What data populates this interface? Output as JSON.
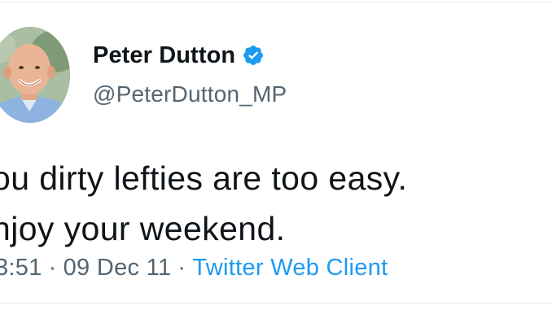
{
  "author": {
    "display_name": "Peter Dutton",
    "handle": "@PeterDutton_MP",
    "verified": true
  },
  "tweet": {
    "lines": [
      "ou dirty lefties are too easy.",
      "njoy your weekend."
    ]
  },
  "meta": {
    "time": "3:51",
    "separator": "·",
    "date": "09 Dec 11",
    "source": "Twitter Web Client"
  },
  "colors": {
    "text": "#0f1419",
    "secondary": "#536471",
    "link": "#1d9bf0",
    "verified": "#1d9bf0"
  },
  "icons": {
    "verified": "verified-badge-icon",
    "avatar": "profile-photo"
  }
}
